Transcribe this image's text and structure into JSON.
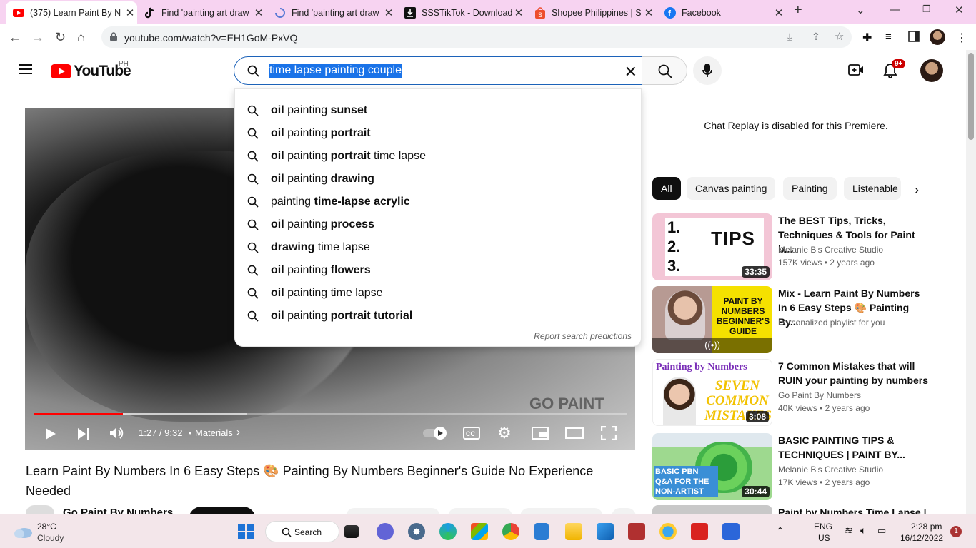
{
  "browser": {
    "tabs": [
      {
        "title": "(375) Learn Paint By N",
        "active": true
      },
      {
        "title": "Find 'painting art draw"
      },
      {
        "title": "Find 'painting art draw"
      },
      {
        "title": "SSSTikTok - Download"
      },
      {
        "title": "Shopee Philippines | S"
      },
      {
        "title": "Facebook"
      }
    ],
    "new_tab": "+",
    "url": "youtube.com/watch?v=EH1GoM-PxVQ"
  },
  "youtube": {
    "logo_text": "YouTube",
    "country_code": "PH",
    "search_query": "time lapse painting couple",
    "notifications_badge": "9+",
    "suggestions": [
      {
        "pre": "oil",
        "mid": " painting ",
        "bold": "sunset",
        "post": ""
      },
      {
        "pre": "oil",
        "mid": " painting ",
        "bold": "portrait",
        "post": ""
      },
      {
        "pre": "oil",
        "mid": " painting ",
        "bold": "portrait",
        "post": " time lapse"
      },
      {
        "pre": "oil",
        "mid": " painting ",
        "bold": "drawing",
        "post": ""
      },
      {
        "pre": "",
        "mid": "painting ",
        "bold": "time-lapse acrylic",
        "post": ""
      },
      {
        "pre": "oil",
        "mid": " painting ",
        "bold": "process",
        "post": ""
      },
      {
        "pre": "drawing",
        "mid": " time lapse",
        "bold": "",
        "post": ""
      },
      {
        "pre": "oil",
        "mid": " painting ",
        "bold": "flowers",
        "post": ""
      },
      {
        "pre": "oil",
        "mid": " painting time lapse",
        "bold": "",
        "post": ""
      },
      {
        "pre": "oil",
        "mid": " painting ",
        "bold": "portrait tutorial",
        "post": ""
      }
    ],
    "report_text": "Report search predictions",
    "player": {
      "time": "1:27 / 9:32",
      "chapter": "Materials",
      "watermark": "GO PAINT",
      "progress_played": 0.15,
      "progress_loaded": 0.36
    },
    "video_title": "Learn Paint By Numbers In 6 Easy Steps 🎨 Painting By Numbers Beginner's Guide No Experience Needed",
    "channel_name": "Go Paint By Numbers",
    "chat_disabled": "Chat Replay is disabled for this Premiere.",
    "chips": [
      "All",
      "Canvas painting",
      "Painting",
      "Listenable"
    ],
    "recommendations": [
      {
        "title": "The BEST Tips, Tricks, Techniques & Tools for Paint b...",
        "channel": "Melanie B's Creative Studio",
        "views": "157K views",
        "age": "2 years ago",
        "duration": "33:35",
        "thumb_text": "TIPS",
        "thumb_bg": "#f3c6d6"
      },
      {
        "title": "Mix - Learn Paint By Numbers In 6 Easy Steps 🎨 Painting By...",
        "channel": "Personalized playlist for you",
        "views": "",
        "age": "",
        "duration": "",
        "thumb_text": "PAINT BY NUMBERS BEGINNER'S GUIDE",
        "thumb_bg": "#f5e100"
      },
      {
        "title": "7 Common Mistakes that will RUIN your painting by numbers",
        "channel": "Go Paint By Numbers",
        "views": "40K views",
        "age": "2 years ago",
        "duration": "3:08",
        "thumb_text": "SEVEN COMMON MISTAKES",
        "thumb_bg": "#ffffff"
      },
      {
        "title": "BASIC PAINTING TIPS & TECHNIQUES | PAINT BY...",
        "channel": "Melanie B's Creative Studio",
        "views": "17K views",
        "age": "2 years ago",
        "duration": "30:44",
        "thumb_text": "BASIC PBN Q&A FOR THE NON-ARTIST",
        "thumb_bg": "#7fcf7a"
      },
      {
        "title": "Paint by Numbers Time Lapse |",
        "channel": "",
        "views": "",
        "age": "",
        "duration": "",
        "thumb_text": "",
        "thumb_bg": "#c8c8c8"
      }
    ]
  },
  "taskbar": {
    "weather_temp": "28°C",
    "weather_desc": "Cloudy",
    "search_label": "Search",
    "lang": "ENG",
    "region": "US",
    "time": "2:28 pm",
    "date": "16/12/2022",
    "notif_count": "1"
  },
  "colors": {
    "yt_red": "#ff0000",
    "tab_bg": "#f7d3f1",
    "select_blue": "#1a73e8"
  }
}
